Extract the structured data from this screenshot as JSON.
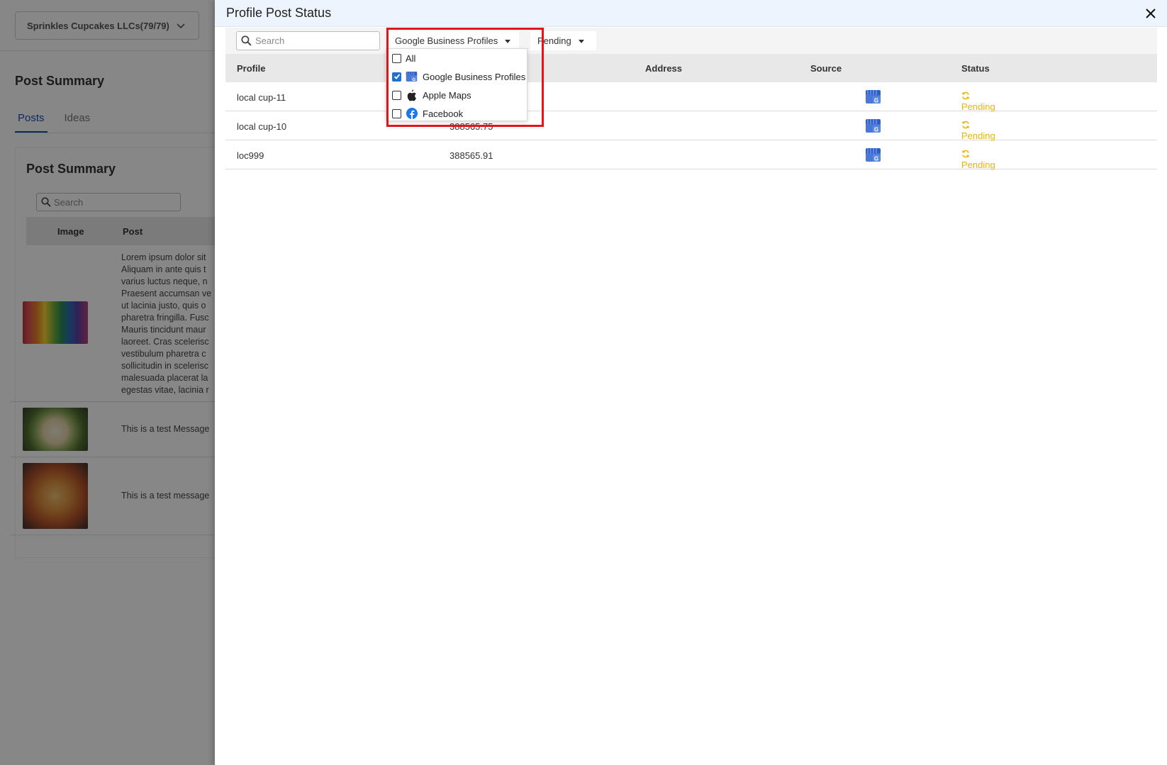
{
  "background": {
    "org_select": "Sprinkles Cupcakes LLCs(79/79)",
    "page_title": "Post Summary",
    "tabs": [
      {
        "label": "Posts",
        "active": true
      },
      {
        "label": "Ideas",
        "active": false
      }
    ],
    "card_title": "Post Summary",
    "search_placeholder": "Search",
    "columns": {
      "image": "Image",
      "post": "Post"
    },
    "posts": [
      {
        "lines": [
          "Lorem ipsum dolor sit",
          "Aliquam in ante quis t",
          "varius luctus neque, n",
          "Praesent accumsan ve",
          "ut lacinia justo, quis o",
          "pharetra fringilla. Fusc",
          "Mauris tincidunt maur",
          "laoreet. Cras scelerisc",
          "vestibulum pharetra c",
          "sollicitudin in scelerisc",
          "malesuada placerat la",
          "egestas vitae, lacinia r"
        ]
      },
      {
        "lines": [
          "This is a test Message"
        ]
      },
      {
        "lines": [
          "This is a test message"
        ]
      }
    ]
  },
  "drawer": {
    "title": "Profile Post Status",
    "close_icon": "close-icon",
    "search_placeholder": "Search",
    "source_filter_label": "Google Business Profiles",
    "status_filter_label": "Pending",
    "source_options": [
      {
        "label": "All",
        "checked": false,
        "icon": ""
      },
      {
        "label": "Google Business Profiles",
        "checked": true,
        "icon": "google-business-icon"
      },
      {
        "label": "Apple Maps",
        "checked": false,
        "icon": "apple-icon"
      },
      {
        "label": "Facebook",
        "checked": false,
        "icon": "facebook-icon"
      }
    ],
    "columns": {
      "profile": "Profile",
      "address": "Address",
      "source": "Source",
      "status": "Status"
    },
    "rows": [
      {
        "profile": "local cup-11",
        "ext": "",
        "address": "",
        "source_icon": "google-business-icon",
        "status": "Pending"
      },
      {
        "profile": "local cup-10",
        "ext": "388565.75",
        "address": "",
        "source_icon": "google-business-icon",
        "status": "Pending"
      },
      {
        "profile": "loc999",
        "ext": "388565.91",
        "address": "",
        "source_icon": "google-business-icon",
        "status": "Pending"
      }
    ]
  },
  "colors": {
    "accent": "#1a4fb5",
    "pending": "#f0b400",
    "highlight": "#e5141b",
    "header_bg": "#eef4fd"
  }
}
